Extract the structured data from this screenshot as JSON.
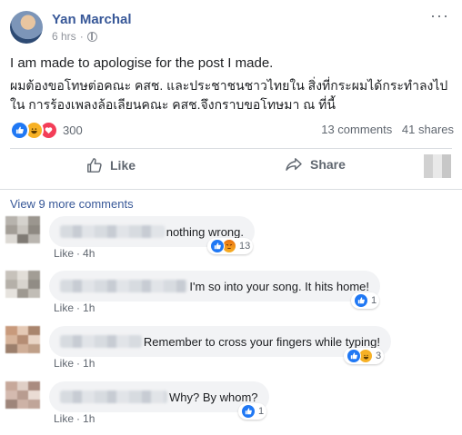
{
  "post": {
    "author": "Yan Marchal",
    "time": "6 hrs",
    "dot": "·",
    "more": "···",
    "text_en": "I am made to apologise for the post I made.",
    "text_th": "ผมต้องขอโทษต่อคณะ คสช. และประชาชนชาวไทยใน สิ่งที่กระผมได้กระทำลงไปใน การร้องเพลงล้อเลียนคณะ คสช.จึงกราบขอโทษมา ณ ที่นี้",
    "reaction_count": "300",
    "comments_count": "13 comments",
    "shares_count": "41 shares",
    "colors": {
      "link": "#385898",
      "like": "#2078f4",
      "love": "#f33e58",
      "haha": "#f7b125"
    }
  },
  "actions": {
    "like_label": "Like",
    "share_label": "Share"
  },
  "view_more": "View 9 more comments",
  "comments": [
    {
      "text": "nothing wrong.",
      "like": "Like",
      "time": "4h",
      "reaction_count": "13",
      "reactions": [
        "like-icon",
        "angry-icon"
      ]
    },
    {
      "text": "I'm so into your song. It hits home!",
      "like": "Like",
      "time": "1h",
      "reaction_count": "1",
      "reactions": [
        "like-icon"
      ]
    },
    {
      "text": "Remember to cross your fingers while typing!",
      "like": "Like",
      "time": "1h",
      "reaction_count": "3",
      "reactions": [
        "like-icon",
        "haha-icon"
      ]
    },
    {
      "text": "Why? By whom?",
      "like": "Like",
      "time": "1h",
      "reaction_count": "1",
      "reactions": [
        "like-icon"
      ]
    }
  ]
}
